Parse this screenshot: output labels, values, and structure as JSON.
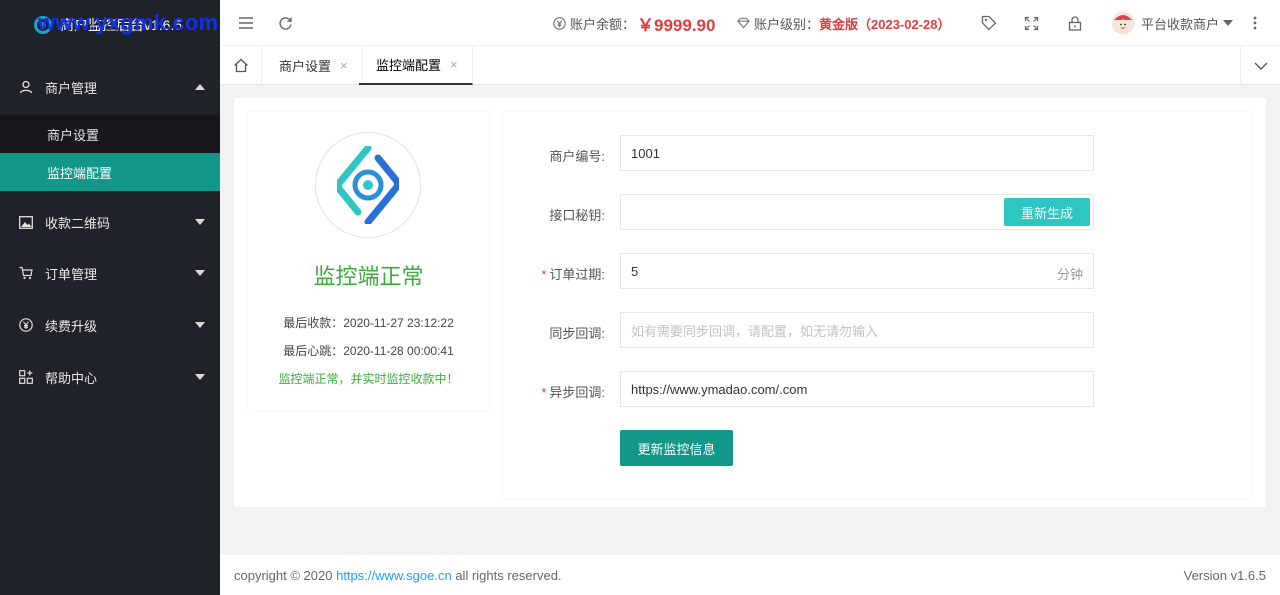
{
  "app": {
    "title": "商户监控后台v1.6.5",
    "watermark": "www.yxgmk.com"
  },
  "sidebar": {
    "groups": [
      {
        "label": "商户管理",
        "icon": "user-icon",
        "expanded": true
      },
      {
        "label": "收款二维码",
        "icon": "image-icon",
        "expanded": false
      },
      {
        "label": "订单管理",
        "icon": "cart-icon",
        "expanded": false
      },
      {
        "label": "续费升级",
        "icon": "yen-icon",
        "expanded": false
      },
      {
        "label": "帮助中心",
        "icon": "apps-icon",
        "expanded": false
      }
    ],
    "sub_items": [
      {
        "label": "商户设置",
        "active": false
      },
      {
        "label": "监控端配置",
        "active": true
      }
    ]
  },
  "header": {
    "balance_label": "账户余额：",
    "balance_value": "￥9999.90",
    "level_label": "账户级别：",
    "level_value": "黄金版（2023-02-28）",
    "user_name": "平台收款商户"
  },
  "tabs": [
    {
      "label": "商户设置",
      "active": false
    },
    {
      "label": "监控端配置",
      "active": true
    }
  ],
  "monitor": {
    "status": "监控端正常",
    "last_payment_label": "最后收款：",
    "last_payment": "2020-11-27 23:12:22",
    "last_heartbeat_label": "最后心跳：",
    "last_heartbeat": "2020-11-28 00:00:41",
    "status_message": "监控端正常，并实时监控收款中！"
  },
  "form": {
    "merchant_id_label": "商户编号:",
    "merchant_id": "1001",
    "api_key_label": "接口秘钥:",
    "api_key": "",
    "regenerate_label": "重新生成",
    "expire_label": "订单过期:",
    "expire_value": "5",
    "expire_unit": "分钟",
    "sync_label": "同步回调:",
    "sync_placeholder": "如有需要同步回调，请配置，如无请勿输入",
    "async_label": "异步回调:",
    "async_value": "https://www.ymadao.com/.com",
    "submit_label": "更新监控信息"
  },
  "footer": {
    "copyright_prefix": "copyright © 2020 ",
    "copyright_link": "https://www.sgoe.cn",
    "copyright_suffix": " all rights reserved.",
    "version": "Version v1.6.5"
  },
  "colors": {
    "accent": "#129788",
    "sidebar_bg": "#20222a",
    "danger": "#e23c3c",
    "success": "#3aad3a",
    "regen_button": "#2dc6c0"
  }
}
